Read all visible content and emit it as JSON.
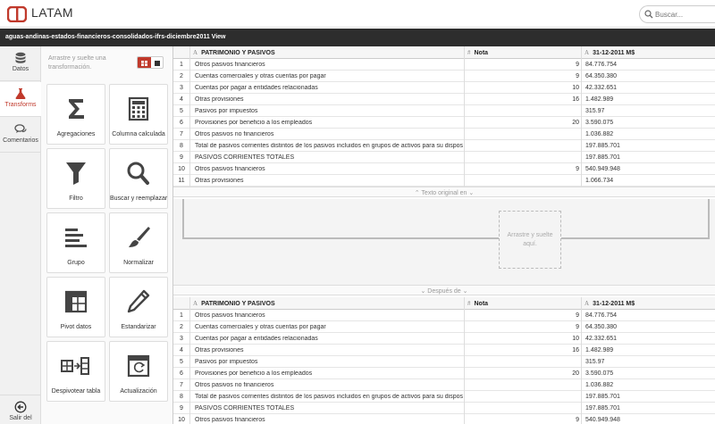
{
  "header": {
    "brand": "LATAM",
    "search_placeholder": "Buscar..."
  },
  "titlebar": {
    "title": "aguas-andinas-estados-financieros-consolidados-ifrs-diciembre2011 View"
  },
  "leftnav": {
    "items": [
      {
        "label": "Datos",
        "icon": "database-icon"
      },
      {
        "label": "Transforms",
        "icon": "flask-icon"
      },
      {
        "label": "Comentarios",
        "icon": "comments-icon"
      }
    ],
    "exit_label": "Salir del"
  },
  "transforms": {
    "hint": "Arrastre y suelte una transformación.",
    "tiles": [
      {
        "label": "Agregaciones",
        "icon": "sigma-icon"
      },
      {
        "label": "Columna calculada",
        "icon": "calculator-icon"
      },
      {
        "label": "Filtro",
        "icon": "filter-icon"
      },
      {
        "label": "Buscar y reemplazar",
        "icon": "search-icon"
      },
      {
        "label": "Grupo",
        "icon": "group-icon"
      },
      {
        "label": "Normalizar",
        "icon": "brush-icon"
      },
      {
        "label": "Pivot datos",
        "icon": "pivot-table-icon"
      },
      {
        "label": "Estandarizar",
        "icon": "pencil-icon"
      },
      {
        "label": "Despivotear tabla",
        "icon": "unpivot-icon"
      },
      {
        "label": "Actualización",
        "icon": "refresh-window-icon"
      }
    ]
  },
  "grid": {
    "columns": [
      {
        "type_glyph": "A",
        "label": "PATRIMONIO Y PASIVOS"
      },
      {
        "type_glyph": "#",
        "label": "Nota"
      },
      {
        "type_glyph": "A",
        "label": "31-12-2011 M$"
      }
    ],
    "rows": [
      {
        "idx": "1",
        "name": "Otros pasivos financieros",
        "note": "9",
        "value": "84.776.754"
      },
      {
        "idx": "2",
        "name": "Cuentas comerciales y otras cuentas por pagar",
        "note": "9",
        "value": "64.350.380"
      },
      {
        "idx": "3",
        "name": "Cuentas por pagar a entidades relacionadas",
        "note": "10",
        "value": "42.332.651"
      },
      {
        "idx": "4",
        "name": "Otras provisiones",
        "note": "16",
        "value": "1.482.989"
      },
      {
        "idx": "5",
        "name": "Pasivos por impuestos",
        "note": "",
        "value": "315.97"
      },
      {
        "idx": "6",
        "name": "Provisiones por beneficio a los empleados",
        "note": "20",
        "value": "3.590.075"
      },
      {
        "idx": "7",
        "name": "Otros pasivos no financieros",
        "note": "",
        "value": "1.036.882"
      },
      {
        "idx": "8",
        "name": "Total de pasivos corrientes distintos de los pasivos incluidos en grupos de activos para su disposición ...",
        "note": "",
        "value": "197.885.701"
      },
      {
        "idx": "9",
        "name": "PASIVOS CORRIENTES TOTALES",
        "note": "",
        "value": "197.885.701"
      },
      {
        "idx": "10",
        "name": "Otros pasivos financieros",
        "note": "9",
        "value": "540.949.948"
      },
      {
        "idx": "11",
        "name": "Otras provisiones",
        "note": "",
        "value": "1.066.734"
      }
    ]
  },
  "middle": {
    "original_label": "⌃ Texto original en ⌄",
    "drop_label": "Arrastre y suelte aquí.",
    "after_label": "⌄ Después de ⌄"
  }
}
